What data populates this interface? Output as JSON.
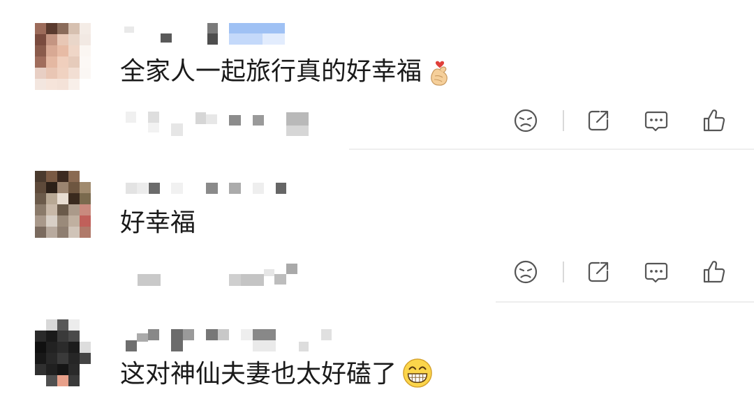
{
  "comments": [
    {
      "text": "全家人一起旅行真的好幸福",
      "emoji": "finger-heart-emoji"
    },
    {
      "text": "好幸福",
      "emoji": ""
    },
    {
      "text": "这对神仙夫妻也太好磕了",
      "emoji": "grinning-face-emoji"
    }
  ],
  "actions": {
    "dislike": "frown-icon",
    "share": "share-icon",
    "reply": "comment-icon",
    "like": "thumbs-up-icon"
  },
  "colors": {
    "background": "#ffffff",
    "text": "#1a1a1a",
    "icon": "#555555",
    "separator": "#eeeeee"
  }
}
